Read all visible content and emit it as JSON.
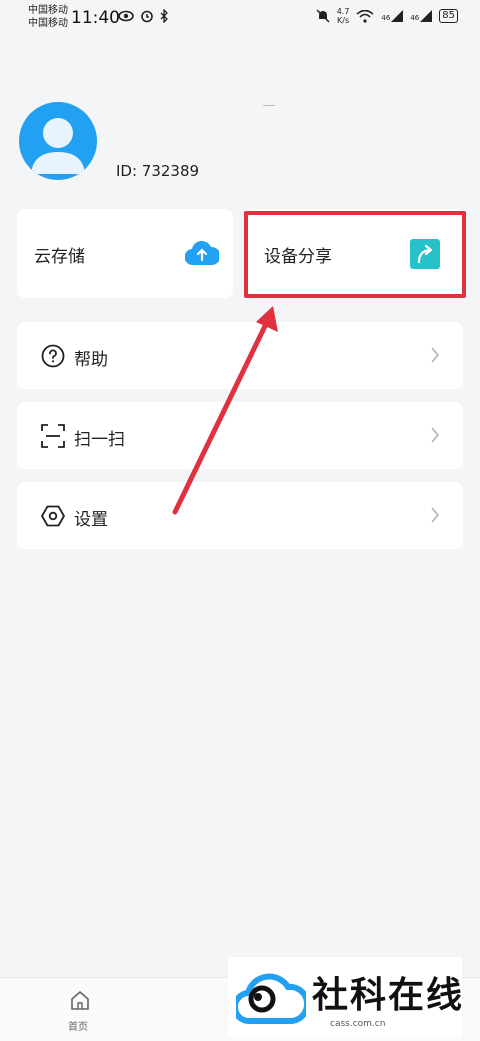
{
  "status_bar": {
    "carrier_1": "中国移动",
    "carrier_2": "中国移动",
    "time": "11:40",
    "speed_value": "4.7",
    "speed_unit": "K/s",
    "signal_1": "46",
    "signal_2": "46",
    "battery": "85"
  },
  "profile": {
    "id_text": "ID: 732389"
  },
  "cards": {
    "cloud_label": "云存储",
    "share_label": "设备分享"
  },
  "menu": {
    "help_label": "帮助",
    "scan_label": "扫一扫",
    "settings_label": "设置"
  },
  "tabbar": {
    "home_label": "首页"
  },
  "watermark": {
    "text": "社科在线",
    "url": "cass.com.cn"
  },
  "colors": {
    "accent_blue": "#22a1f2",
    "share_teal": "#27c2c9",
    "highlight_red": "#e0313f"
  }
}
